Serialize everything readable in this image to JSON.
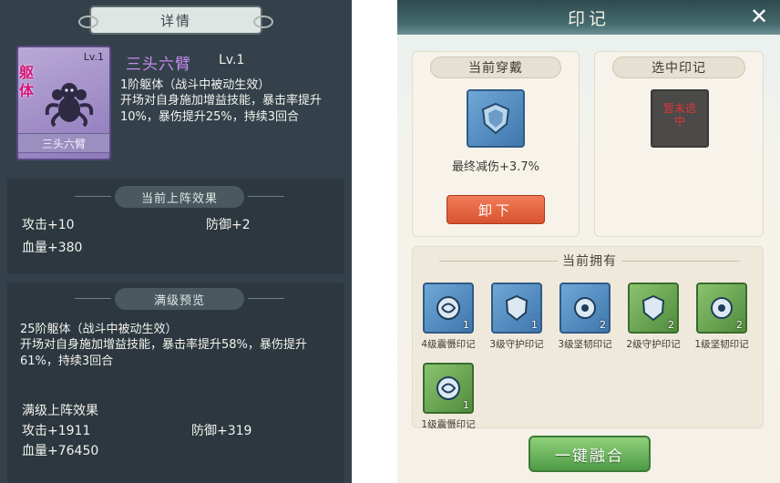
{
  "left": {
    "title": "详情",
    "card": {
      "level": "Lv.1",
      "tag": "躯体",
      "name": "三头六臂"
    },
    "skill": {
      "name": "三头六臂",
      "level": "Lv.1",
      "type": "1阶躯体（战斗中被动生效）",
      "desc": "开场对自身施加增益技能，暴击率提升10%，暴伤提升25%，持续3回合"
    },
    "current_effect": {
      "title": "当前上阵效果",
      "attack": "攻击+10",
      "defense": "防御+2",
      "hp": "血量+380"
    },
    "max_preview": {
      "title": "满级预览",
      "type": "25阶躯体（战斗中被动生效）",
      "desc": "开场对自身施加增益技能，暴击率提升58%，暴伤提升61%，持续3回合",
      "effect_title": "满级上阵效果",
      "attack": "攻击+1911",
      "defense": "防御+319",
      "hp": "血量+76450"
    }
  },
  "right": {
    "title": "印记",
    "close_icon": "✕",
    "wearing": {
      "title": "当前穿戴",
      "stat": "最终减伤+3.7%",
      "unequip_label": "卸下"
    },
    "selected": {
      "title": "选中印记",
      "empty_text": "暂未选中"
    },
    "owned": {
      "title": "当前拥有",
      "items": [
        {
          "label": "4级震慑印记",
          "count": "1",
          "color": "blue",
          "icon": "swirl-rune-icon"
        },
        {
          "label": "3级守护印记",
          "count": "1",
          "color": "blue",
          "icon": "shield-rune-icon"
        },
        {
          "label": "3级坚韧印记",
          "count": "2",
          "color": "blue",
          "icon": "ring-rune-icon"
        },
        {
          "label": "2级守护印记",
          "count": "2",
          "color": "green",
          "icon": "shield-rune-icon"
        },
        {
          "label": "1级坚韧印记",
          "count": "2",
          "color": "green",
          "icon": "ring-rune-icon"
        },
        {
          "label": "1级震慑印记",
          "count": "1",
          "color": "green",
          "icon": "swirl-rune-icon"
        }
      ]
    },
    "fuse_label": "一键融合"
  }
}
